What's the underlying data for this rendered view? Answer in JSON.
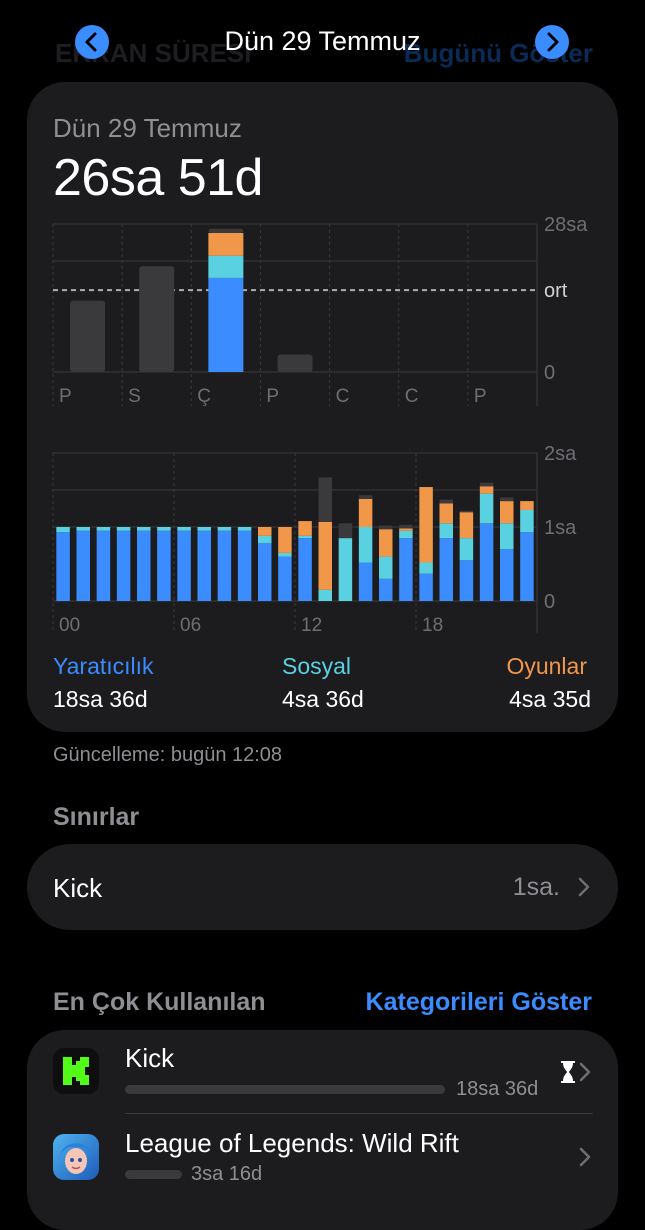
{
  "header": {
    "bg_title": "EKRAN SÜRESİ",
    "bg_link": "Bugünü Göster",
    "title": "Dün 29 Temmuz"
  },
  "summary": {
    "date": "Dün 29 Temmuz",
    "total": "26sa 51d"
  },
  "chart_data": [
    {
      "type": "bar",
      "categories": [
        "P",
        "S",
        "Ç",
        "P",
        "C",
        "C",
        "P"
      ],
      "series": [
        {
          "name": "Yaratıcılık",
          "values": [
            0,
            0,
            17.8,
            0,
            0,
            0,
            0
          ]
        },
        {
          "name": "Sosyal",
          "values": [
            0,
            0,
            4.2,
            0,
            0,
            0,
            0
          ]
        },
        {
          "name": "Oyunlar",
          "values": [
            0,
            0,
            4.3,
            0,
            0,
            0,
            0
          ]
        },
        {
          "name": "",
          "values": [
            13.5,
            20.0,
            0.8,
            3.3,
            0,
            0,
            0
          ]
        }
      ],
      "ytick_labels": [
        "28sa",
        "ort",
        "0"
      ],
      "ylim": [
        0,
        28
      ],
      "average": 15.5,
      "colors": [
        "#3a8cff",
        "#5ad1e0",
        "#f0974a",
        "#3a3a3c"
      ]
    },
    {
      "type": "bar",
      "categories": [
        "00",
        "01",
        "02",
        "03",
        "04",
        "05",
        "06",
        "07",
        "08",
        "09",
        "10",
        "11",
        "12",
        "13",
        "14",
        "15",
        "16",
        "17",
        "18",
        "19",
        "20",
        "21",
        "22",
        "23"
      ],
      "xtick_labels": [
        "00",
        "06",
        "12",
        "18"
      ],
      "series": [
        {
          "name": "Yaratıcılık",
          "values": [
            0.93,
            0.95,
            0.95,
            0.95,
            0.95,
            0.95,
            0.95,
            0.95,
            0.95,
            0.95,
            0.78,
            0.6,
            0.85,
            0,
            0,
            0.52,
            0.3,
            0.85,
            0.37,
            0.85,
            0.55,
            1.05,
            0.7,
            0.93
          ]
        },
        {
          "name": "Sosyal",
          "values": [
            0.07,
            0.05,
            0.05,
            0.05,
            0.05,
            0.05,
            0.05,
            0.05,
            0.05,
            0.05,
            0.1,
            0.05,
            0.03,
            0.15,
            0.85,
            0.48,
            0.3,
            0.1,
            0.15,
            0.2,
            0.3,
            0.4,
            0.35,
            0.3
          ]
        },
        {
          "name": "Oyunlar",
          "values": [
            0,
            0,
            0,
            0,
            0,
            0,
            0,
            0,
            0,
            0,
            0.12,
            0.35,
            0.2,
            0.92,
            0,
            0.38,
            0.37,
            0.03,
            1.02,
            0.27,
            0.35,
            0.1,
            0.3,
            0.12
          ]
        },
        {
          "name": "",
          "values": [
            0,
            0,
            0,
            0,
            0,
            0,
            0,
            0,
            0,
            0,
            0,
            0,
            0,
            0.6,
            0.2,
            0.05,
            0.05,
            0.05,
            0,
            0.05,
            0.02,
            0.05,
            0.05,
            0
          ]
        }
      ],
      "ytick_labels": [
        "2sa",
        "1sa",
        "0"
      ],
      "ylim": [
        0,
        2
      ],
      "colors": [
        "#3a8cff",
        "#5ad1e0",
        "#f0974a",
        "#3a3a3c"
      ]
    }
  ],
  "categories": [
    {
      "label": "Yaratıcılık",
      "value": "18sa 36d",
      "color": "#3a8cff"
    },
    {
      "label": "Sosyal",
      "value": "4sa 36d",
      "color": "#5ad1e0"
    },
    {
      "label": "Oyunlar",
      "value": "4sa 35d",
      "color": "#f0974a"
    }
  ],
  "updated": "Güncelleme: bugün 12:08",
  "limits": {
    "heading": "Sınırlar",
    "items": [
      {
        "label": "Kick",
        "value": "1sa."
      }
    ]
  },
  "most_used": {
    "heading": "En Çok Kullanılan",
    "link": "Kategorileri Göster",
    "apps": [
      {
        "name": "Kick",
        "time": "18sa 36d",
        "icon": "kick-app-icon",
        "usage_fraction": 1.0
      },
      {
        "name": "League of Legends: Wild Rift",
        "time": "3sa 16d",
        "icon": "wild-rift-app-icon",
        "usage_fraction": 0.18
      }
    ]
  }
}
